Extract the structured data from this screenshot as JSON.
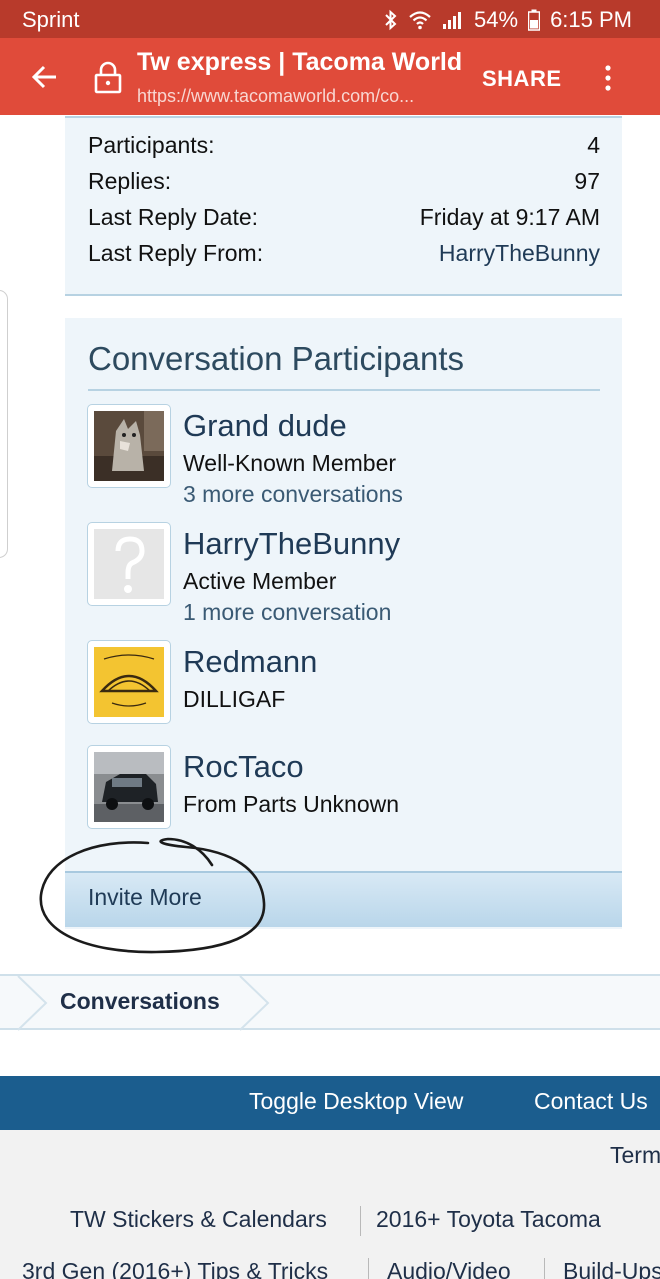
{
  "status_bar": {
    "carrier": "Sprint",
    "battery": "54%",
    "time": "6:15 PM"
  },
  "app_bar": {
    "title": "Tw express | Tacoma World",
    "url": "https://www.tacomaworld.com/co...",
    "share_label": "SHARE"
  },
  "info": {
    "rows": [
      {
        "label": "Participants:",
        "value": "4"
      },
      {
        "label": "Replies:",
        "value": "97"
      },
      {
        "label": "Last Reply Date:",
        "value": "Friday at 9:17 AM"
      },
      {
        "label": "Last Reply From:",
        "value": "HarryTheBunny"
      }
    ]
  },
  "participants": {
    "heading": "Conversation Participants",
    "list": [
      {
        "name": "Grand dude",
        "role": "Well-Known Member",
        "more": "3 more conversations"
      },
      {
        "name": "HarryTheBunny",
        "role": "Active Member",
        "more": "1 more conversation"
      },
      {
        "name": "Redmann",
        "role": "DILLIGAF"
      },
      {
        "name": "RocTaco",
        "role": "From Parts Unknown"
      }
    ],
    "invite_label": "Invite More"
  },
  "breadcrumb": {
    "label": "Conversations"
  },
  "footer": {
    "toggle_desktop": "Toggle Desktop View",
    "contact_us": "Contact Us",
    "terms": "Terms",
    "links_row1": [
      "TW Stickers & Calendars",
      "2016+ Toyota Tacoma"
    ],
    "links_row2": [
      "3rd Gen (2016+) Tips & Tricks",
      "Audio/Video",
      "Build-Ups"
    ]
  },
  "colors": {
    "status_bar": "#b83a2b",
    "app_bar": "#e04b3a",
    "panel_bg": "#eef5fa",
    "footer_bar": "#1b5d8e"
  }
}
